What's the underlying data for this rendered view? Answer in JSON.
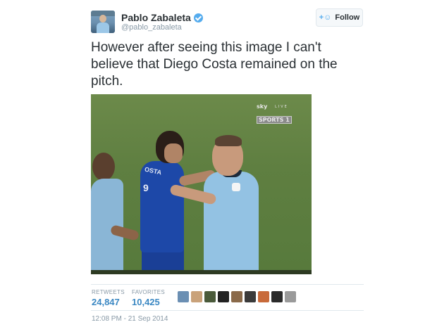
{
  "user": {
    "display_name": "Pablo Zabaleta",
    "handle": "@pablo_zabaleta",
    "verified": true
  },
  "follow_button": {
    "label": "Follow",
    "icon": "add-user-icon"
  },
  "tweet": {
    "text": "However after seeing this image I can't believe that Diego Costa remained on the pitch."
  },
  "media": {
    "broadcaster": {
      "sky": "sky",
      "sports": "SPORTS 1",
      "live": "LIVE"
    },
    "shirt_name": "OSTA",
    "shirt_number": "9"
  },
  "stats": {
    "retweets_label": "RETWEETS",
    "retweets_value": "24,847",
    "favorites_label": "FAVORITES",
    "favorites_value": "10,425"
  },
  "favoriters": [
    {
      "color": "#6b8fb3"
    },
    {
      "color": "#c9a27a"
    },
    {
      "color": "#4a5a3a"
    },
    {
      "color": "#222222"
    },
    {
      "color": "#8a6a4a"
    },
    {
      "color": "#3a3a3a"
    },
    {
      "color": "#c86a3a"
    },
    {
      "color": "#2a2a2a"
    },
    {
      "color": "#9a9a9a"
    }
  ],
  "timestamp": "12:08 PM - 21 Sep 2014",
  "colors": {
    "accent": "#55acee",
    "stat_value": "#3b88c3",
    "muted": "#8899a6"
  }
}
